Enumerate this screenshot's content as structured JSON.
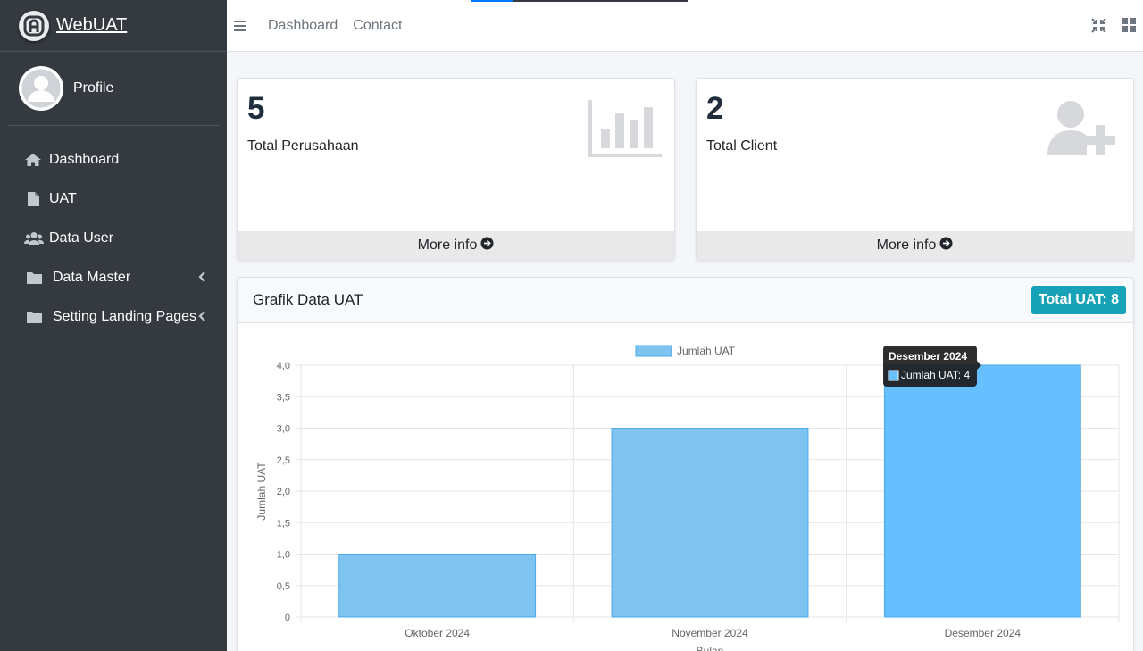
{
  "brand": {
    "name": "WebUAT"
  },
  "user": {
    "name": "Profile"
  },
  "sidebar": {
    "items": [
      {
        "label": "Dashboard",
        "icon": "home-icon"
      },
      {
        "label": "UAT",
        "icon": "file-icon"
      },
      {
        "label": "Data User",
        "icon": "users-icon"
      },
      {
        "label": "Data Master",
        "icon": "folder-icon"
      },
      {
        "label": "Setting Landing Pages",
        "icon": "folder-icon"
      }
    ]
  },
  "header": {
    "links": [
      "Dashboard",
      "Contact"
    ]
  },
  "stats": [
    {
      "value": "5",
      "label": "Total Perusahaan",
      "more": "More info",
      "icon": "bar-chart-icon"
    },
    {
      "value": "2",
      "label": "Total Client",
      "more": "More info",
      "icon": "user-plus-icon"
    }
  ],
  "chart_card": {
    "title": "Grafik Data UAT",
    "badge": "Total UAT: 8"
  },
  "chart_data": {
    "type": "bar",
    "categories": [
      "Oktober 2024",
      "November 2024",
      "Desember 2024"
    ],
    "series": [
      {
        "name": "Jumlah UAT",
        "values": [
          1,
          3,
          4
        ]
      }
    ],
    "ylabel": "Jumlah UAT",
    "xlabel": "Bulan",
    "ylim": [
      0,
      4
    ],
    "yticks": [
      "0",
      "0,5",
      "1,0",
      "1,5",
      "2,0",
      "2,5",
      "3,0",
      "3,5",
      "4,0"
    ],
    "legend": "top-center",
    "grid": true,
    "tooltip": {
      "title": "Desember 2024",
      "text": "Jumlah UAT: 4"
    },
    "colors": {
      "bar": "#7fc3f0",
      "bar_border": "#4aa8e8",
      "bar_hover": "#66bfff"
    }
  }
}
